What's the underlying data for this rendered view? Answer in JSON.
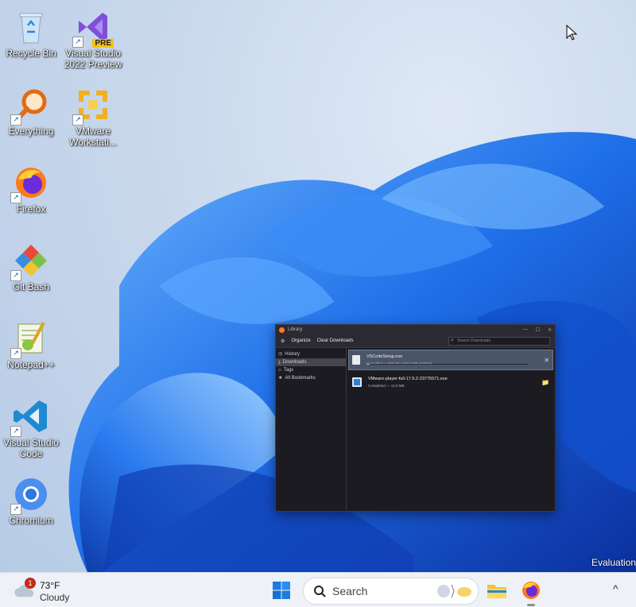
{
  "desktop": {
    "icons": [
      {
        "label": "Recycle Bin",
        "icon": "recycle-bin-icon"
      },
      {
        "label": "Visual Studio\n2022 Preview",
        "icon": "visual-studio-preview-icon",
        "badge": "PRE"
      },
      {
        "label": "Everything",
        "icon": "everything-search-icon"
      },
      {
        "label": "VMware\nWorkstati...",
        "icon": "vmware-icon"
      },
      {
        "label": "Firefox",
        "icon": "firefox-icon"
      },
      {
        "label": "Git Bash",
        "icon": "git-bash-icon"
      },
      {
        "label": "Notepad++",
        "icon": "notepadpp-icon"
      },
      {
        "label": "Visual Studio\nCode",
        "icon": "vscode-icon"
      },
      {
        "label": "Chromium",
        "icon": "chromium-icon"
      }
    ],
    "watermark": "Evaluation"
  },
  "library": {
    "title": "Library",
    "toolbar": {
      "organize": "Organize",
      "clear": "Clear Downloads",
      "search_placeholder": "Search Downloads"
    },
    "sidebar": [
      "History",
      "Downloads",
      "Tags",
      "All Bookmarks"
    ],
    "downloads": [
      {
        "name": "VSCodeSetup.exe",
        "status": "Cancelled — 566 KB of 93.8 MB (stalled)",
        "action": "✕",
        "progress": 0.02
      },
      {
        "name": "VMware-player-full-17.5.2-23775571.exe",
        "status": "Completed — 12.0 MB",
        "action": "📁"
      }
    ]
  },
  "taskbar": {
    "weather": {
      "badge": "1",
      "temp": "73°F",
      "condition": "Cloudy"
    },
    "search_label": "Search",
    "tray_chevron": "^"
  },
  "colors": {
    "taskbar": "#eef1f6",
    "library_bg": "#1c1b22",
    "selected_row": "#4a5568"
  }
}
